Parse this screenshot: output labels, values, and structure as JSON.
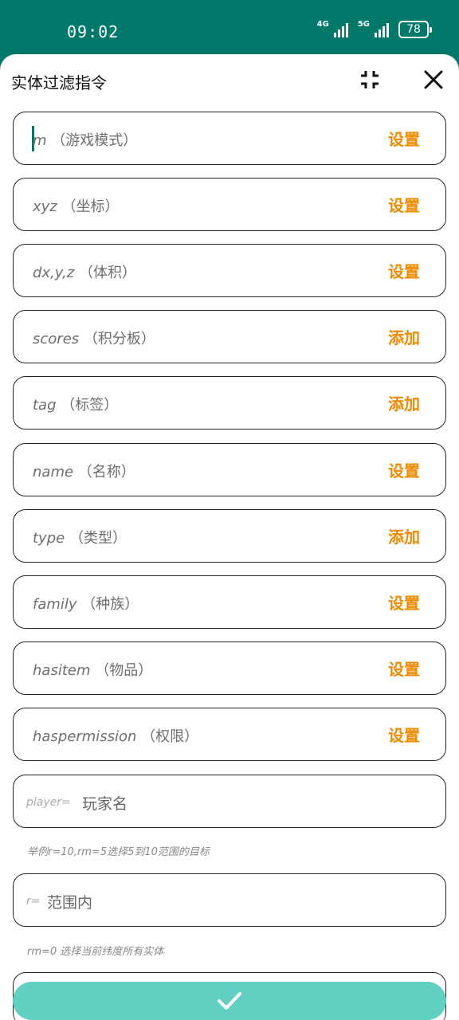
{
  "status": {
    "time": "09:02",
    "net1": "4G",
    "net2": "5G",
    "battery": "78"
  },
  "sheet": {
    "title": "实体过滤指令"
  },
  "rows": [
    {
      "en": "m",
      "zh": "（游戏模式）",
      "action": "设置"
    },
    {
      "en": "xyz",
      "zh": "（坐标）",
      "action": "设置"
    },
    {
      "en": "dx,y,z",
      "zh": "（体积）",
      "action": "设置"
    },
    {
      "en": "scores",
      "zh": "（积分板）",
      "action": "添加"
    },
    {
      "en": "tag",
      "zh": "（标签）",
      "action": "添加"
    },
    {
      "en": "name",
      "zh": "（名称）",
      "action": "设置"
    },
    {
      "en": "type",
      "zh": "（类型）",
      "action": "添加"
    },
    {
      "en": "family",
      "zh": "（种族）",
      "action": "设置"
    },
    {
      "en": "hasitem",
      "zh": "（物品）",
      "action": "设置"
    },
    {
      "en": "haspermission",
      "zh": "（权限）",
      "action": "设置"
    }
  ],
  "player_input": {
    "prefix": "player=",
    "placeholder": "玩家名"
  },
  "hint1": "举例r=10,rm=5选择5到10范围的目标",
  "r_input": {
    "prefix": "r=",
    "placeholder": "范围内"
  },
  "hint2": "rm=0 选择当前纬度所有实体",
  "colors": {
    "accent": "#f08a00",
    "primary": "#00796b",
    "confirm": "#5fd0c2"
  }
}
